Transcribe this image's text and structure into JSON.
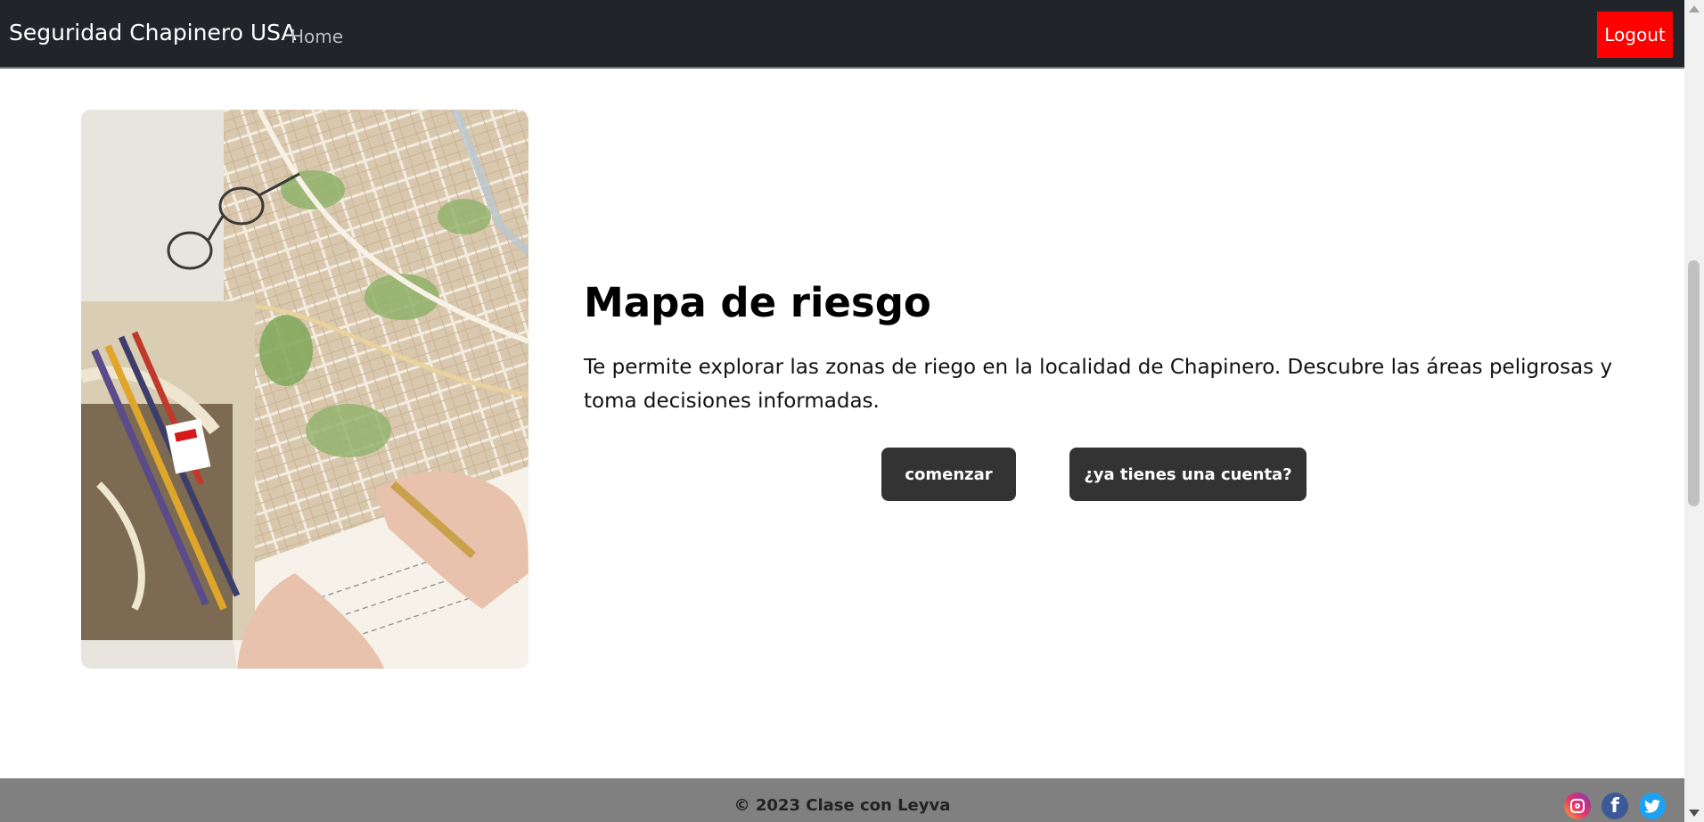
{
  "navbar": {
    "brand": "Seguridad Chapinero USA",
    "home_label": "Home",
    "logout_label": "Logout",
    "background_color": "#212529",
    "logout_color": "#ff0000"
  },
  "hero": {
    "title": "Mapa de riesgo",
    "description": "Te permite explorar las zonas de riego en la localidad de Chapinero. Descubre las áreas peligrosas y toma decisiones informadas.",
    "start_button": "comenzar",
    "account_button": "¿ya tienes una cuenta?",
    "button_color": "#333333",
    "image": "map-with-glasses-pencils-and-notebook-photo"
  },
  "footer": {
    "copyright": "© 2023 Clase con Leyva",
    "background_color": "#808080",
    "social_icons": [
      "instagram-icon",
      "facebook-icon",
      "twitter-icon"
    ]
  },
  "scrollbar": {
    "scroll_position": 0.5
  }
}
